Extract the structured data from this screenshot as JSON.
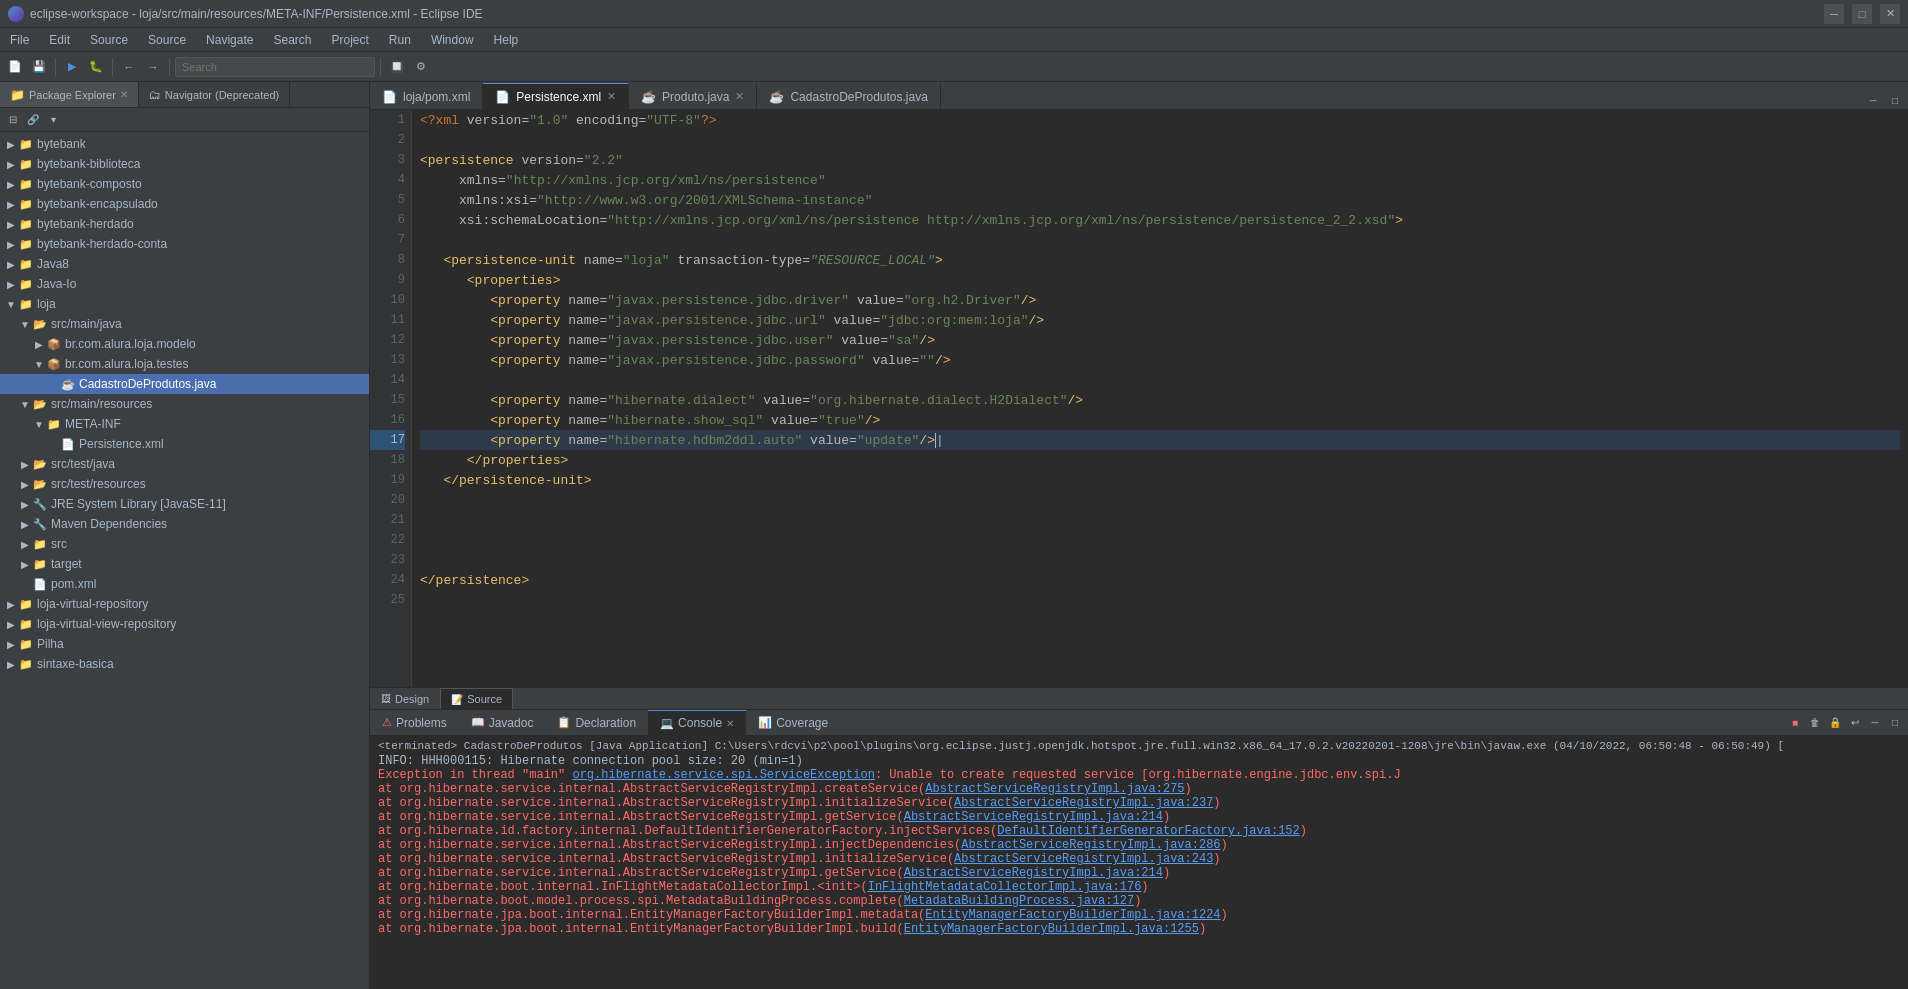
{
  "titlebar": {
    "title": "eclipse-workspace - loja/src/main/resources/META-INF/Persistence.xml - Eclipse IDE",
    "icon": "eclipse-icon",
    "controls": [
      "minimize",
      "maximize",
      "close"
    ]
  },
  "menubar": {
    "items": [
      "File",
      "Edit",
      "Source",
      "Source",
      "Navigate",
      "Search",
      "Project",
      "Run",
      "Window",
      "Help"
    ]
  },
  "search_placeholder": "Search",
  "sidebar": {
    "tabs": [
      {
        "label": "Package Explorer",
        "active": true,
        "closeable": true
      },
      {
        "label": "Navigator (Deprecated)",
        "active": false,
        "closeable": false
      }
    ],
    "tree": [
      {
        "level": 0,
        "label": "bytebank",
        "type": "project",
        "expanded": false
      },
      {
        "level": 0,
        "label": "bytebank-biblioteca",
        "type": "project",
        "expanded": false
      },
      {
        "level": 0,
        "label": "bytebank-composto",
        "type": "project",
        "expanded": false
      },
      {
        "level": 0,
        "label": "bytebank-encapsulado",
        "type": "project",
        "expanded": false
      },
      {
        "level": 0,
        "label": "bytebank-herdado",
        "type": "project",
        "expanded": false
      },
      {
        "level": 0,
        "label": "bytebank-herdado-conta",
        "type": "project",
        "expanded": false
      },
      {
        "level": 0,
        "label": "Java8",
        "type": "project",
        "expanded": false
      },
      {
        "level": 0,
        "label": "Java-Io",
        "type": "project",
        "expanded": false
      },
      {
        "level": 0,
        "label": "loja",
        "type": "project",
        "expanded": true
      },
      {
        "level": 1,
        "label": "src/main/java",
        "type": "folder",
        "expanded": true
      },
      {
        "level": 2,
        "label": "br.com.alura.loja.modelo",
        "type": "package",
        "expanded": false
      },
      {
        "level": 2,
        "label": "br.com.alura.loja.testes",
        "type": "package",
        "expanded": true
      },
      {
        "level": 3,
        "label": "CadastroDeProdutos.java",
        "type": "java",
        "selected": true
      },
      {
        "level": 1,
        "label": "src/main/resources",
        "type": "folder",
        "expanded": true
      },
      {
        "level": 2,
        "label": "META-INF",
        "type": "folder",
        "expanded": true
      },
      {
        "level": 3,
        "label": "Persistence.xml",
        "type": "xml"
      },
      {
        "level": 1,
        "label": "src/test/java",
        "type": "folder",
        "expanded": false
      },
      {
        "level": 1,
        "label": "src/test/resources",
        "type": "folder",
        "expanded": false
      },
      {
        "level": 1,
        "label": "JRE System Library [JavaSE-11]",
        "type": "library"
      },
      {
        "level": 1,
        "label": "Maven Dependencies",
        "type": "library"
      },
      {
        "level": 1,
        "label": "src",
        "type": "folder"
      },
      {
        "level": 1,
        "label": "target",
        "type": "folder"
      },
      {
        "level": 1,
        "label": "pom.xml",
        "type": "xml"
      },
      {
        "level": 0,
        "label": "loja-virtual-repository",
        "type": "project"
      },
      {
        "level": 0,
        "label": "loja-virtual-view-repository",
        "type": "project"
      },
      {
        "level": 0,
        "label": "Pilha",
        "type": "project"
      },
      {
        "level": 0,
        "label": "sintaxe-basica",
        "type": "project"
      }
    ]
  },
  "editor": {
    "tabs": [
      {
        "label": "loja/pom.xml",
        "type": "xml",
        "active": false,
        "closeable": false
      },
      {
        "label": "Persistence.xml",
        "type": "xml",
        "active": true,
        "closeable": true
      },
      {
        "label": "Produto.java",
        "type": "java",
        "active": false,
        "closeable": true
      },
      {
        "label": "CadastroDeProdutos.java",
        "type": "java",
        "active": false,
        "closeable": false
      }
    ],
    "lines": [
      {
        "num": 1,
        "content": "<?xml version=\"1.0\" encoding=\"UTF-8\"?>"
      },
      {
        "num": 2,
        "content": ""
      },
      {
        "num": 3,
        "content": "<persistence version=\"2.2\""
      },
      {
        "num": 4,
        "content": "     xmlns=\"http://xmlns.jcp.org/xml/ns/persistence\""
      },
      {
        "num": 5,
        "content": "     xmlns:xsi=\"http://www.w3.org/2001/XMLSchema-instance\""
      },
      {
        "num": 6,
        "content": "     xsi:schemaLocation=\"http://xmlns.jcp.org/xml/ns/persistence http://xmlns.jcp.org/xml/ns/persistence/persistence_2_2.xsd\">"
      },
      {
        "num": 7,
        "content": ""
      },
      {
        "num": 8,
        "content": "   <persistence-unit name=\"loja\" transaction-type=\"RESOURCE_LOCAL\">"
      },
      {
        "num": 9,
        "content": "      <properties>"
      },
      {
        "num": 10,
        "content": "         <property name=\"javax.persistence.jdbc.driver\" value=\"org.h2.Driver\"/>"
      },
      {
        "num": 11,
        "content": "         <property name=\"javax.persistence.jdbc.url\" value=\"jdbc:org:mem:loja\"/>"
      },
      {
        "num": 12,
        "content": "         <property name=\"javax.persistence.jdbc.user\" value=\"sa\"/>"
      },
      {
        "num": 13,
        "content": "         <property name=\"javax.persistence.jdbc.password\" value=\"\"/>"
      },
      {
        "num": 14,
        "content": ""
      },
      {
        "num": 15,
        "content": "         <property name=\"hibernate.dialect\" value=\"org.hibernate.dialect.H2Dialect\"/>"
      },
      {
        "num": 16,
        "content": "         <property name=\"hibernate.show_sql\" value=\"true\"/>"
      },
      {
        "num": 17,
        "content": "         <property name=\"hibernate.hdbm2ddl.auto\" value=\"update\"/>",
        "active": true
      },
      {
        "num": 18,
        "content": "      </properties>"
      },
      {
        "num": 19,
        "content": "   </persistence-unit>"
      },
      {
        "num": 20,
        "content": ""
      },
      {
        "num": 21,
        "content": ""
      },
      {
        "num": 22,
        "content": ""
      },
      {
        "num": 23,
        "content": ""
      },
      {
        "num": 24,
        "content": "</persistence>"
      },
      {
        "num": 25,
        "content": ""
      }
    ],
    "design_source_tabs": [
      {
        "label": "Design",
        "active": false
      },
      {
        "label": "Source",
        "active": true
      }
    ]
  },
  "bottom_panel": {
    "tabs": [
      {
        "label": "Problems",
        "active": false,
        "closeable": false,
        "icon": "problems-icon"
      },
      {
        "label": "Javadoc",
        "active": false,
        "closeable": false,
        "icon": "javadoc-icon"
      },
      {
        "label": "Declaration",
        "active": false,
        "closeable": false,
        "icon": "declaration-icon"
      },
      {
        "label": "Console",
        "active": true,
        "closeable": true,
        "icon": "console-icon"
      },
      {
        "label": "Coverage",
        "active": false,
        "closeable": false,
        "icon": "coverage-icon"
      }
    ],
    "console": {
      "header": "<terminated> CadastroDeProdutos [Java Application] C:\\Users\\rdcvi\\p2\\pool\\plugins\\org.eclipse.justj.openjdk.hotspot.jre.full.win32.x86_64_17.0.2.v20220201-1208\\jre\\bin\\javaw.exe  (04/10/2022, 06:50:48 - 06:50:49) [",
      "lines": [
        {
          "type": "info",
          "text": "INFO: HHH000115: Hibernate connection pool size: 20 (min=1)"
        },
        {
          "type": "error",
          "text": "Exception in thread \"main\" org.hibernate.service.spi.ServiceException: Unable to create requested service [org.hibernate.engine.jdbc.env.spi.J"
        },
        {
          "type": "stack",
          "text": "\tat org.hibernate.service.internal.AbstractServiceRegistryImpl.createService(AbstractServiceRegistryImpl.java:275)"
        },
        {
          "type": "stack",
          "text": "\tat org.hibernate.service.internal.AbstractServiceRegistryImpl.initializeService(AbstractServiceRegistryImpl.java:237)"
        },
        {
          "type": "stack",
          "text": "\tat org.hibernate.service.internal.AbstractServiceRegistryImpl.getService(AbstractServiceRegistryImpl.java:214)"
        },
        {
          "type": "stack",
          "text": "\tat org.hibernate.id.factory.internal.DefaultIdentifierGeneratorFactory.injectServices(DefaultIdentifierGeneratorFactory.java:152)"
        },
        {
          "type": "stack",
          "text": "\tat org.hibernate.service.internal.AbstractServiceRegistryImpl.injectDependencies(AbstractServiceRegistryImpl.java:286)"
        },
        {
          "type": "stack",
          "text": "\tat org.hibernate.service.internal.AbstractServiceRegistryImpl.initializeService(AbstractServiceRegistryImpl.java:243)"
        },
        {
          "type": "stack",
          "text": "\tat org.hibernate.service.internal.AbstractServiceRegistryImpl.getService(AbstractServiceRegistryImpl.java:214)"
        },
        {
          "type": "stack",
          "text": "\tat org.hibernate.boot.internal.InFlightMetadataCollectorImpl.<init>(InFlightMetadataCollectorImpl.java:176)"
        },
        {
          "type": "stack",
          "text": "\tat org.hibernate.boot.model.process.spi.MetadataBuildingProcess.complete(MetadataBuildingProcess.java:127)"
        },
        {
          "type": "stack",
          "text": "\tat org.hibernate.jpa.boot.internal.EntityManagerFactoryBuilderImpl.metadata(EntityManagerFactoryBuilderImpl.java:1224)"
        },
        {
          "type": "stack",
          "text": "\tat org.hibernate.jpa.boot.internal.EntityManagerFactoryBuilderImpl.build(EntityManagerFactoryBuilderImpl.java:1255)"
        }
      ]
    }
  }
}
